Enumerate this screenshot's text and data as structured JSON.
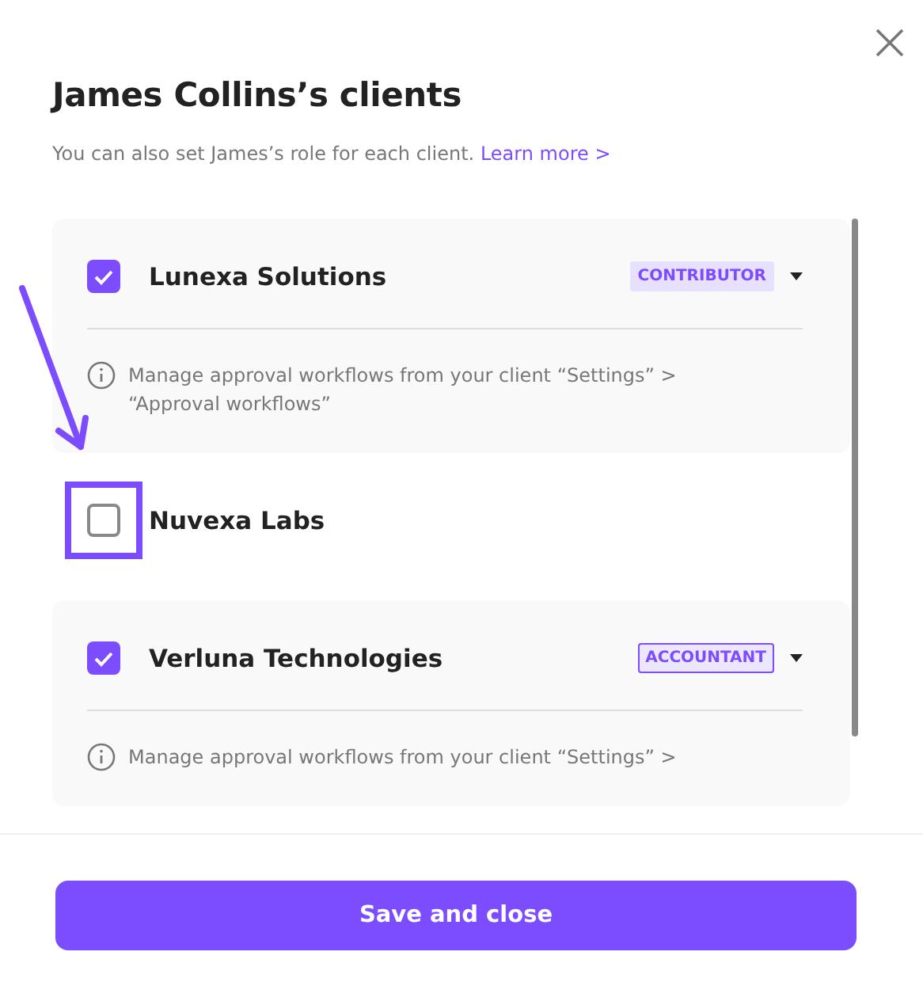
{
  "dialog": {
    "title": "James Collins’s clients",
    "subtitle": "You can also set James’s role for each client.",
    "learn_more": "Learn more >"
  },
  "clients": [
    {
      "name": "Lunexa Solutions",
      "checked": true,
      "highlighted": false,
      "role": "CONTRIBUTOR",
      "role_outlined": false,
      "note": "Manage approval workflows from your client “Settings” > “Approval workflows”"
    },
    {
      "name": "Nuvexa Labs",
      "checked": false,
      "highlighted": true
    },
    {
      "name": "Verluna Technologies",
      "checked": true,
      "highlighted": false,
      "role": "ACCOUNTANT",
      "role_outlined": true,
      "note": "Manage approval workflows from your client “Settings” >"
    }
  ],
  "save_button": "Save and close"
}
